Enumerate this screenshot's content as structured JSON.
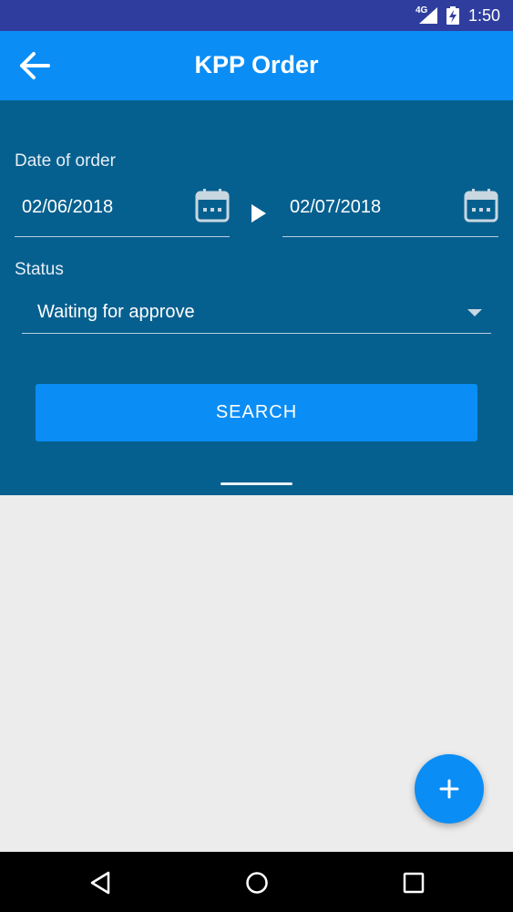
{
  "status_bar": {
    "network": "4G",
    "time": "1:50"
  },
  "app_bar": {
    "title": "KPP Order",
    "back_icon": "arrow-left-icon"
  },
  "filter": {
    "date_label": "Date of order",
    "date_from": "02/06/2018",
    "date_to": "02/07/2018",
    "status_label": "Status",
    "status_value": "Waiting for approve",
    "search_label": "SEARCH"
  },
  "fab": {
    "icon": "plus-icon"
  },
  "nav": {
    "back_icon": "triangle-back-icon",
    "home_icon": "circle-home-icon",
    "recents_icon": "square-recents-icon"
  },
  "colors": {
    "status_bar": "#2f3e9e",
    "app_bar": "#0a8df5",
    "panel": "#06608f",
    "background": "#ececec",
    "accent": "#0a8df5"
  }
}
